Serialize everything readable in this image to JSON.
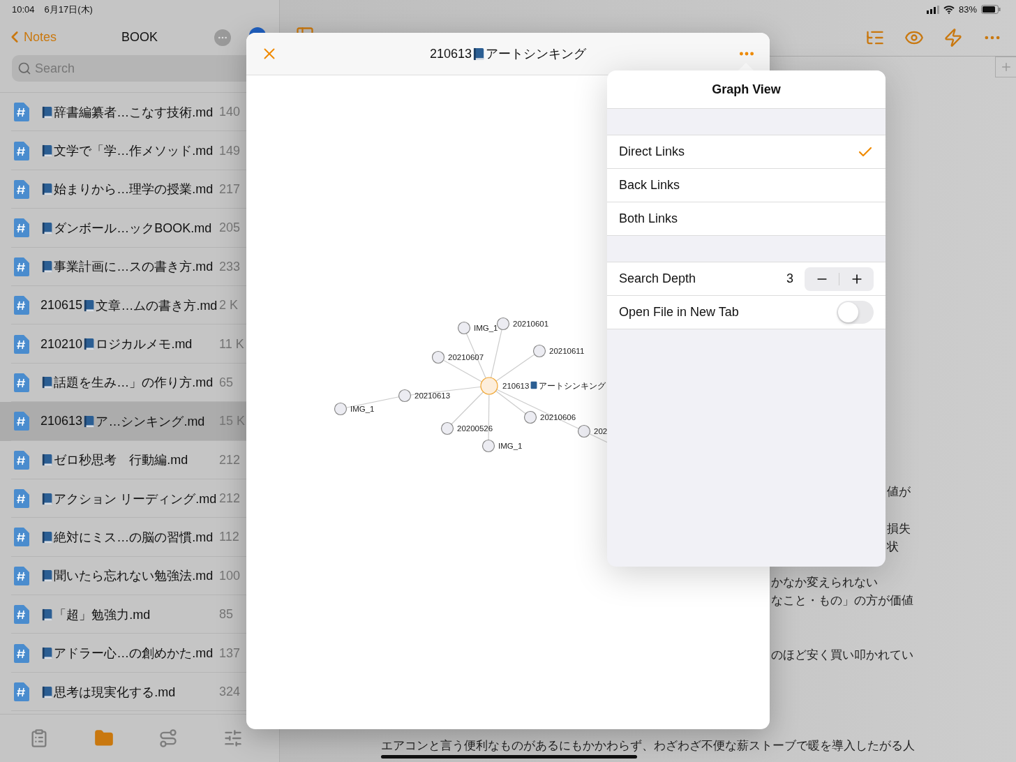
{
  "status_bar": {
    "time": "10:04",
    "date": "6月17日(木)",
    "battery": "83%"
  },
  "sidebar": {
    "back": "Notes",
    "title": "BOOK",
    "search": {
      "placeholder": "Search"
    },
    "files": [
      {
        "name": "辞書編纂者…こなす技術.md",
        "size": "140",
        "selected": false
      },
      {
        "name": "文学で「学…作メソッド.md",
        "size": "149",
        "selected": false
      },
      {
        "name": "始まりから…理学の授業.md",
        "size": "217",
        "selected": false
      },
      {
        "name": "ダンボール…ックBOOK.md",
        "size": "205",
        "selected": false
      },
      {
        "name": "事業計画に…スの書き方.md",
        "size": "233",
        "selected": false
      },
      {
        "prefix": "210615",
        "name": "文章…ムの書き方.md",
        "size": "2 K",
        "selected": false
      },
      {
        "prefix": "210210",
        "name": "ロジカルメモ.md",
        "size": "11 K",
        "selected": false
      },
      {
        "name": "話題を生み…」の作り方.md",
        "size": "65",
        "selected": false
      },
      {
        "prefix": "210613",
        "name": "ア…シンキング.md",
        "size": "15 K",
        "selected": true
      },
      {
        "name": "ゼロ秒思考　行動編.md",
        "size": "212",
        "selected": false
      },
      {
        "name": "アクション リーディング.md",
        "size": "212",
        "selected": false
      },
      {
        "name": "絶対にミス…の脳の習慣.md",
        "size": "112",
        "selected": false
      },
      {
        "name": "聞いたら忘れない勉強法.md",
        "size": "100",
        "selected": false
      },
      {
        "name": "「超」勉強力.md",
        "size": "85",
        "selected": false
      },
      {
        "name": "アドラー心…の創めかた.md",
        "size": "137",
        "selected": false
      },
      {
        "name": "思考は現実化する.md",
        "size": "324",
        "selected": false
      }
    ],
    "toolbar": [
      {
        "kind": "clipboard",
        "selected": false
      },
      {
        "kind": "folder",
        "selected": true
      },
      {
        "kind": "route",
        "selected": false
      },
      {
        "kind": "sliders",
        "selected": false
      }
    ]
  },
  "editor": {
    "lines": [
      {
        "text": "値が",
        "kind": "behind-popover"
      },
      {
        "text": "損失",
        "kind": "behind-popover"
      },
      {
        "text": "状",
        "kind": "behind-popover"
      },
      {
        "text": "かなか変えられない",
        "kind": "behind-modal"
      },
      {
        "text": "なこと・もの」の方が価値",
        "kind": "behind-modal"
      },
      {
        "text": "のほど安く買い叩かれてい",
        "kind": "behind-modal"
      },
      {
        "text": "エアコンと言う便利なものがあるにもかかわらず、わざわざ不便な薪ストーブで暖を導入したがる人",
        "kind": "full"
      }
    ]
  },
  "modal": {
    "title_prefix": "210613",
    "title": "アートシンキング",
    "graph": {
      "nodes": [
        {
          "kind": "current",
          "prefix": "210613",
          "label": "アートシンキング"
        },
        {
          "kind": "note",
          "label": "IMG_1"
        },
        {
          "kind": "note",
          "label": "20210601"
        },
        {
          "kind": "note",
          "label": "20210607"
        },
        {
          "kind": "note",
          "label": "20210611"
        },
        {
          "kind": "note",
          "label": "20210613"
        },
        {
          "kind": "note",
          "label": "IMG_1"
        },
        {
          "kind": "note",
          "label": "20200526"
        },
        {
          "kind": "note",
          "label": "IMG_1"
        },
        {
          "kind": "note",
          "label": "20210606"
        },
        {
          "kind": "note",
          "label": "202"
        }
      ]
    }
  },
  "popover": {
    "title": "Graph View",
    "link_modes": [
      {
        "label": "Direct Links",
        "selected": true
      },
      {
        "label": "Back Links",
        "selected": false
      },
      {
        "label": "Both Links",
        "selected": false
      }
    ],
    "search_depth": {
      "label": "Search Depth",
      "value": "3"
    },
    "open_in_new_tab": {
      "label": "Open File in New Tab",
      "on": false
    }
  }
}
